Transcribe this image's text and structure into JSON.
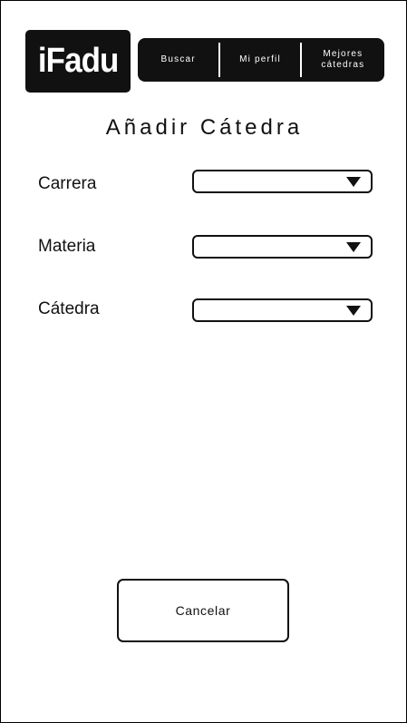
{
  "header": {
    "logo_text": "iFadu",
    "nav": [
      {
        "label": "Buscar"
      },
      {
        "label": "Mi perfil"
      },
      {
        "label": "Mejores\ncátedras"
      }
    ]
  },
  "page": {
    "title": "Añadir Cátedra"
  },
  "form": {
    "fields": [
      {
        "label": "Carrera",
        "value": ""
      },
      {
        "label": "Materia",
        "value": ""
      },
      {
        "label": "Cátedra",
        "value": ""
      }
    ]
  },
  "actions": {
    "cancel_label": "Cancelar"
  },
  "colors": {
    "primary": "#111111",
    "background": "#ffffff"
  },
  "icons": {
    "dropdown": "triangle-down-icon"
  }
}
